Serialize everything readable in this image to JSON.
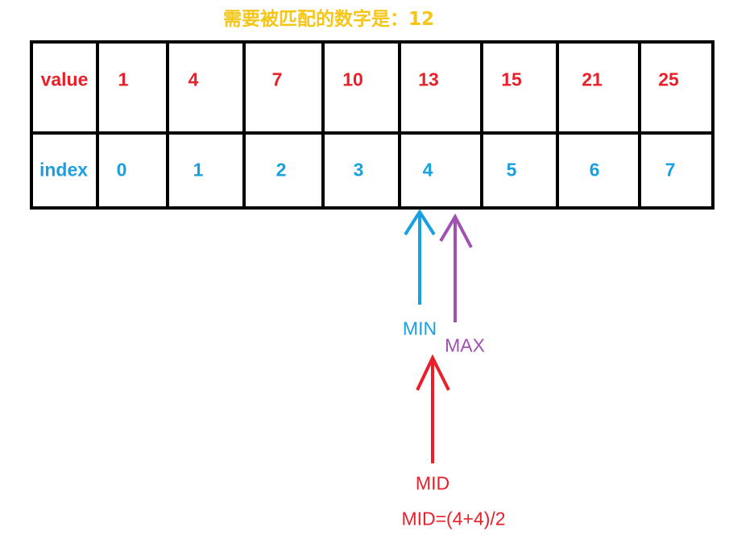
{
  "title": "需要被匹配的数字是：12",
  "table": {
    "value_label": "value",
    "index_label": "index",
    "values": [
      "1",
      "4",
      "7",
      "10",
      "13",
      "15",
      "21",
      "25"
    ],
    "indices": [
      "0",
      "1",
      "2",
      "3",
      "4",
      "5",
      "6",
      "7"
    ]
  },
  "markers": {
    "min_label": "MIN",
    "max_label": "MAX",
    "mid_label": "MID",
    "mid_formula": "MID=(4+4)/2"
  },
  "colors": {
    "title": "#f5c518",
    "value_text": "#e8202a",
    "index_text": "#1aa0e0",
    "min": "#1aa0e0",
    "max": "#a050b0",
    "mid": "#e8202a",
    "grid": "#000000"
  }
}
